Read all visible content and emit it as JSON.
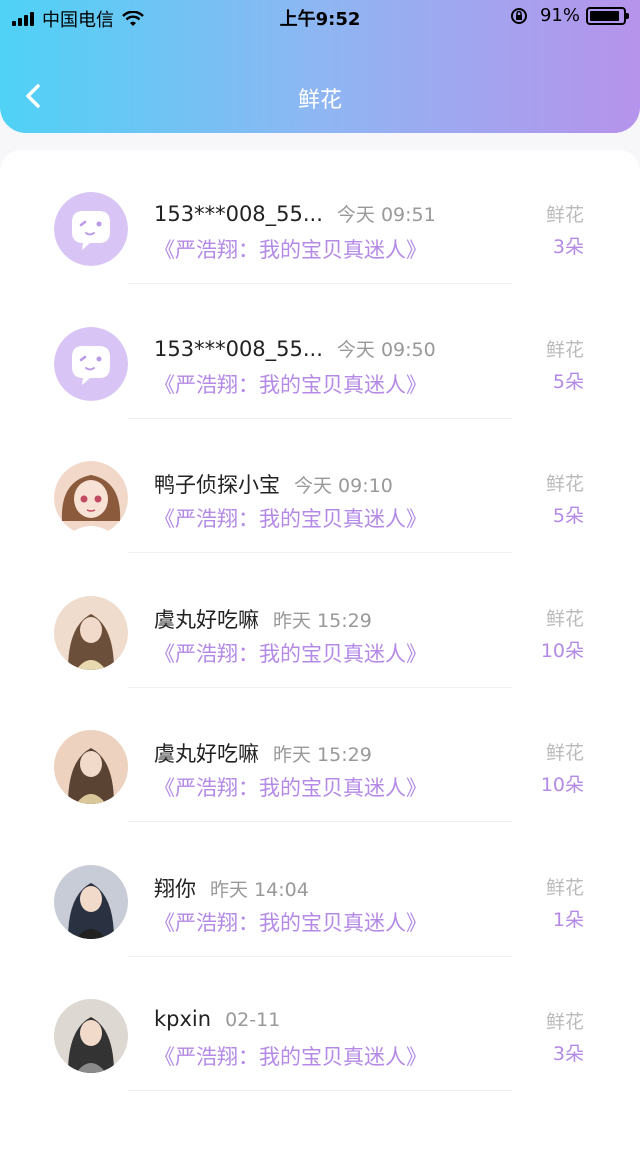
{
  "status_bar": {
    "carrier": "中国电信",
    "time": "上午9:52",
    "battery": "91%"
  },
  "header": {
    "title": "鲜花"
  },
  "list": [
    {
      "name": "153***008_55...",
      "time": "今天 09:51",
      "subtitle": "《严浩翔：我的宝贝真迷人》",
      "gift": "鲜花",
      "count": "3朵",
      "avatar": "default-avatar"
    },
    {
      "name": "153***008_55...",
      "time": "今天 09:50",
      "subtitle": "《严浩翔：我的宝贝真迷人》",
      "gift": "鲜花",
      "count": "5朵",
      "avatar": "default-avatar"
    },
    {
      "name": "鸭子侦探小宝",
      "time": "今天 09:10",
      "subtitle": "《严浩翔：我的宝贝真迷人》",
      "gift": "鲜花",
      "count": "5朵",
      "avatar": "anime-girl-avatar"
    },
    {
      "name": "虞丸好吃嘛",
      "time": "昨天 15:29",
      "subtitle": "《严浩翔：我的宝贝真迷人》",
      "gift": "鲜花",
      "count": "10朵",
      "avatar": "photo-avatar"
    },
    {
      "name": "虞丸好吃嘛",
      "time": "昨天 15:29",
      "subtitle": "《严浩翔：我的宝贝真迷人》",
      "gift": "鲜花",
      "count": "10朵",
      "avatar": "photo-avatar"
    },
    {
      "name": "翔你",
      "time": "昨天 14:04",
      "subtitle": "《严浩翔：我的宝贝真迷人》",
      "gift": "鲜花",
      "count": "1朵",
      "avatar": "photo-avatar"
    },
    {
      "name": "kpxin",
      "time": "02-11",
      "subtitle": "《严浩翔：我的宝贝真迷人》",
      "gift": "鲜花",
      "count": "3朵",
      "avatar": "photo-avatar"
    }
  ]
}
